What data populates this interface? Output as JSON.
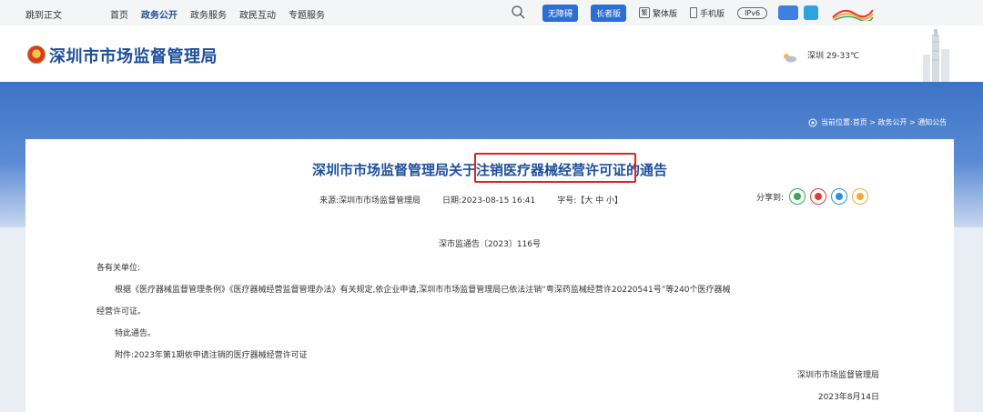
{
  "topbar": {
    "skip_label": "跳到正文",
    "nav": [
      "首页",
      "政务公开",
      "政务服务",
      "政民互动",
      "专题服务"
    ],
    "active_nav": "政务公开",
    "accessibility_label": "无障碍",
    "elder_label": "长者版",
    "traditional_icon": "繁",
    "traditional_label": "繁体版",
    "mobile_label": "手机版",
    "ipv6_label": "IPv6"
  },
  "header": {
    "site_title": "深圳市市场监督管理局",
    "weather": "深圳 29-33℃"
  },
  "breadcrumb": {
    "prefix": "当前位置:",
    "path": "首页 > 政务公开 > 通知公告"
  },
  "article": {
    "title_before": "深圳市市场监督管理局关于",
    "title_highlight": "注销医疗器械经营许可证",
    "title_after": "的通告",
    "source": "来源:深圳市市场监督管理局",
    "date": "日期:2023-08-15 16:41",
    "font_size_label": "字号:【大 中 小】",
    "share_label": "分享到:",
    "doc_number": "深市监通告〔2023〕116号",
    "salutation": "各有关单位:",
    "para1_line1": "根据《医疗器械监督管理条例》《医疗器械经营监督管理办法》有关规定,依企业申请,深圳市市场监督管理局已依法注销“粤深药监械经营许20220541号”等240个医疗器械",
    "para1_line2": "经营许可证。",
    "notice": "特此通告。",
    "attachment": "附件:2023年第1期依申请注销的医疗器械经营许可证",
    "signer": "深圳市市场监督管理局",
    "sign_date": "2023年8月14日"
  },
  "colors": {
    "brand_blue": "#1d4f9a",
    "highlight_red": "#e0231b",
    "pill_blue": "#2b6fd6"
  }
}
